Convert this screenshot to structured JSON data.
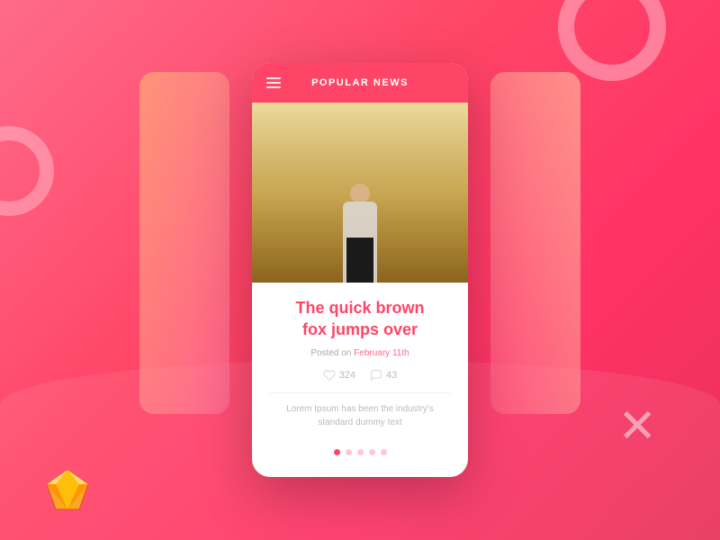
{
  "background": {
    "gradient_start": "#ff6b8a",
    "gradient_end": "#e8305a"
  },
  "header": {
    "title": "POPULAR NEWS",
    "hamburger_label": "Menu"
  },
  "article": {
    "title_line1": "The quick brown",
    "title_line2": "fox jumps over",
    "posted_label": "Posted on",
    "posted_date": "February 11th",
    "likes_count": "324",
    "comments_count": "43",
    "excerpt": "Lorem Ipsum has been the industry's standard dummy text"
  },
  "pagination": {
    "dots": [
      true,
      false,
      false,
      false,
      false
    ],
    "active_index": 0
  },
  "icons": {
    "hamburger": "☰",
    "heart": "♡",
    "comment": "💬",
    "x_shape": "✕",
    "circle": "○"
  }
}
